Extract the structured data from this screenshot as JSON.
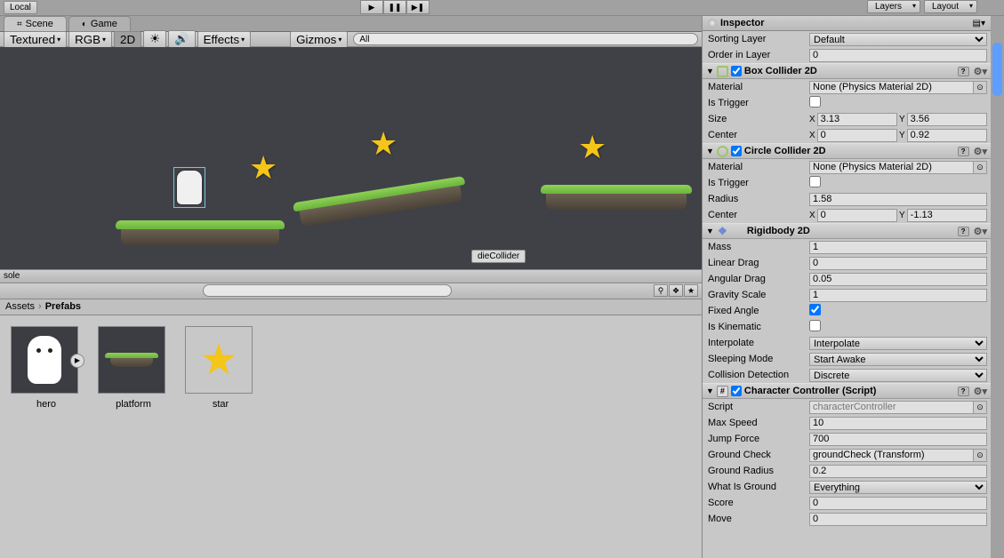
{
  "toolbar": {
    "local": "Local",
    "layers": "Layers",
    "layout": "Layout"
  },
  "tabs": {
    "scene": "Scene",
    "game": "Game"
  },
  "sceneToolbar": {
    "textured": "Textured",
    "rgb": "RGB",
    "twoD": "2D",
    "effects": "Effects",
    "gizmos": "Gizmos",
    "searchPrefix": "All"
  },
  "sceneLabels": {
    "dieCollider": "dieCollider"
  },
  "console": {
    "label": "sole"
  },
  "breadcrumb": {
    "assets": "Assets",
    "prefabs": "Prefabs"
  },
  "assets": [
    {
      "name": "hero",
      "type": "ghost"
    },
    {
      "name": "platform",
      "type": "platform"
    },
    {
      "name": "star",
      "type": "star"
    }
  ],
  "inspector": {
    "header": "Inspector",
    "sortingLayer": {
      "label": "Sorting Layer",
      "value": "Default"
    },
    "orderInLayer": {
      "label": "Order in Layer",
      "value": "0"
    },
    "boxCollider": {
      "title": "Box Collider 2D",
      "materialLabel": "Material",
      "materialValue": "None (Physics Material 2D)",
      "isTriggerLabel": "Is Trigger",
      "sizeLabel": "Size",
      "sizeX": "3.13",
      "sizeY": "3.56",
      "centerLabel": "Center",
      "centerX": "0",
      "centerY": "0.92"
    },
    "circleCollider": {
      "title": "Circle Collider 2D",
      "materialLabel": "Material",
      "materialValue": "None (Physics Material 2D)",
      "isTriggerLabel": "Is Trigger",
      "radiusLabel": "Radius",
      "radiusValue": "1.58",
      "centerLabel": "Center",
      "centerX": "0",
      "centerY": "-1.13"
    },
    "rigidbody": {
      "title": "Rigidbody 2D",
      "massLabel": "Mass",
      "massValue": "1",
      "linearDragLabel": "Linear Drag",
      "linearDragValue": "0",
      "angularDragLabel": "Angular Drag",
      "angularDragValue": "0.05",
      "gravityScaleLabel": "Gravity Scale",
      "gravityScaleValue": "1",
      "fixedAngleLabel": "Fixed Angle",
      "isKinematicLabel": "Is Kinematic",
      "interpolateLabel": "Interpolate",
      "interpolateValue": "Interpolate",
      "sleepingModeLabel": "Sleeping Mode",
      "sleepingModeValue": "Start Awake",
      "collisionDetectionLabel": "Collision Detection",
      "collisionDetectionValue": "Discrete"
    },
    "characterController": {
      "title": "Character Controller (Script)",
      "scriptLabel": "Script",
      "scriptValue": "characterController",
      "maxSpeedLabel": "Max Speed",
      "maxSpeedValue": "10",
      "jumpForceLabel": "Jump Force",
      "jumpForceValue": "700",
      "groundCheckLabel": "Ground Check",
      "groundCheckValue": "groundCheck (Transform)",
      "groundRadiusLabel": "Ground Radius",
      "groundRadiusValue": "0.2",
      "whatIsGroundLabel": "What Is Ground",
      "whatIsGroundValue": "Everything",
      "scoreLabel": "Score",
      "scoreValue": "0",
      "moveLabel": "Move",
      "moveValue": "0"
    }
  }
}
